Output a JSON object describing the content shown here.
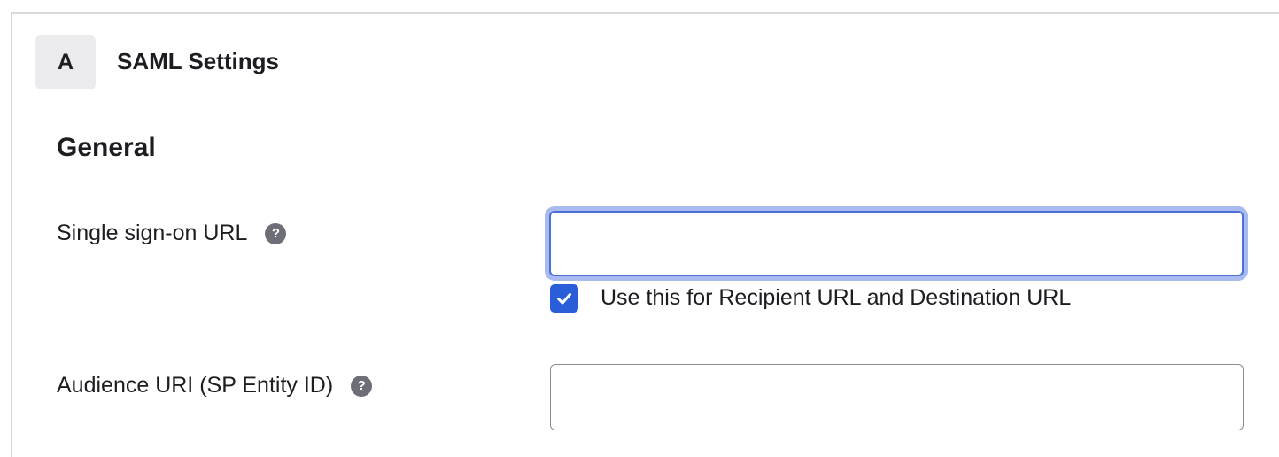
{
  "step": {
    "badge": "A",
    "title": "SAML Settings"
  },
  "section": {
    "heading": "General"
  },
  "fields": {
    "sso_url": {
      "label": "Single sign-on URL",
      "value": "",
      "help_icon": "question-circle-icon"
    },
    "recipient_checkbox": {
      "label": "Use this for Recipient URL and Destination URL",
      "checked": true,
      "icon": "checkmark-icon"
    },
    "audience_uri": {
      "label": "Audience URI (SP Entity ID)",
      "value": "",
      "help_icon": "question-circle-icon"
    }
  },
  "colors": {
    "accent": "#2a5ed8",
    "focus_ring": "#a9baf0",
    "help_icon": "#6e6e78",
    "badge_bg": "#ebebed"
  }
}
